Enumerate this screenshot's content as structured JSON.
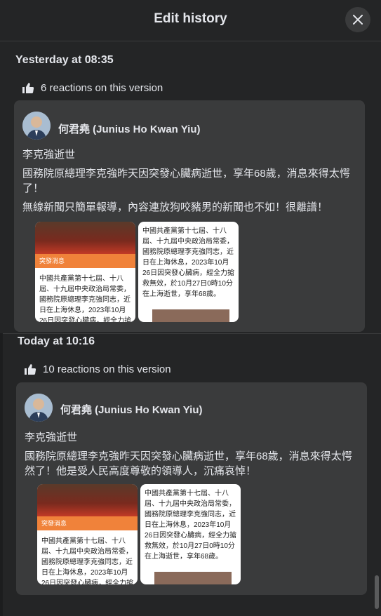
{
  "header": {
    "title": "Edit history"
  },
  "versions": [
    {
      "time": "Yesterday at 08:35",
      "reactions": "6 reactions on this version",
      "author": "何君堯 (Junius Ho Kwan Yiu)",
      "lines": [
        "李克強逝世",
        "國務院原總理李克強昨天因突發心臟病逝世，享年68歲，消息來得太愕了！",
        "無線新聞只簡單報導，內容連放狗咬豬男的新聞也不如！很離譜！"
      ],
      "thumb1": {
        "band": "突發消息",
        "text": "中國共產黨第十七屆、十八屆、十九屆中央政治局常委，國務院原總理李克強同志，近日在上海休息，2023年10月26日因突發心臟病，經全力搶救"
      },
      "thumb2": {
        "text": "中國共產黨第十七屆、十八屆、十九屆中央政治局常委，國務院原總理李克強同志，近日在上海休息，2023年10月26日因突發心臟病，經全力搶救無效，於10月27日0時10分在上海逝世，享年68歲。"
      }
    },
    {
      "time": "Today at 10:16",
      "reactions": "10 reactions on this version",
      "author": "何君堯 (Junius Ho Kwan Yiu)",
      "lines": [
        "李克強逝世",
        "國務院原總理李克強昨天因突發心臟病逝世，享年68歲，消息來得太愕然了！他是受人民高度尊敬的領導人，沉痛哀悼！"
      ],
      "thumb1": {
        "band": "突發消息",
        "text": "中國共產黨第十七屆、十八屆、十九屆中央政治局常委，國務院原總理李克強同志，近日在上海休息，2023年10月26日因突發心臟病，經全力搶救"
      },
      "thumb2": {
        "text": "中國共產黨第十七屆、十八屆、十九屆中央政治局常委，國務院原總理李克強同志，近日在上海休息，2023年10月26日因突發心臟病，經全力搶救無效，於10月27日0時10分在上海逝世，享年68歲。"
      }
    }
  ]
}
